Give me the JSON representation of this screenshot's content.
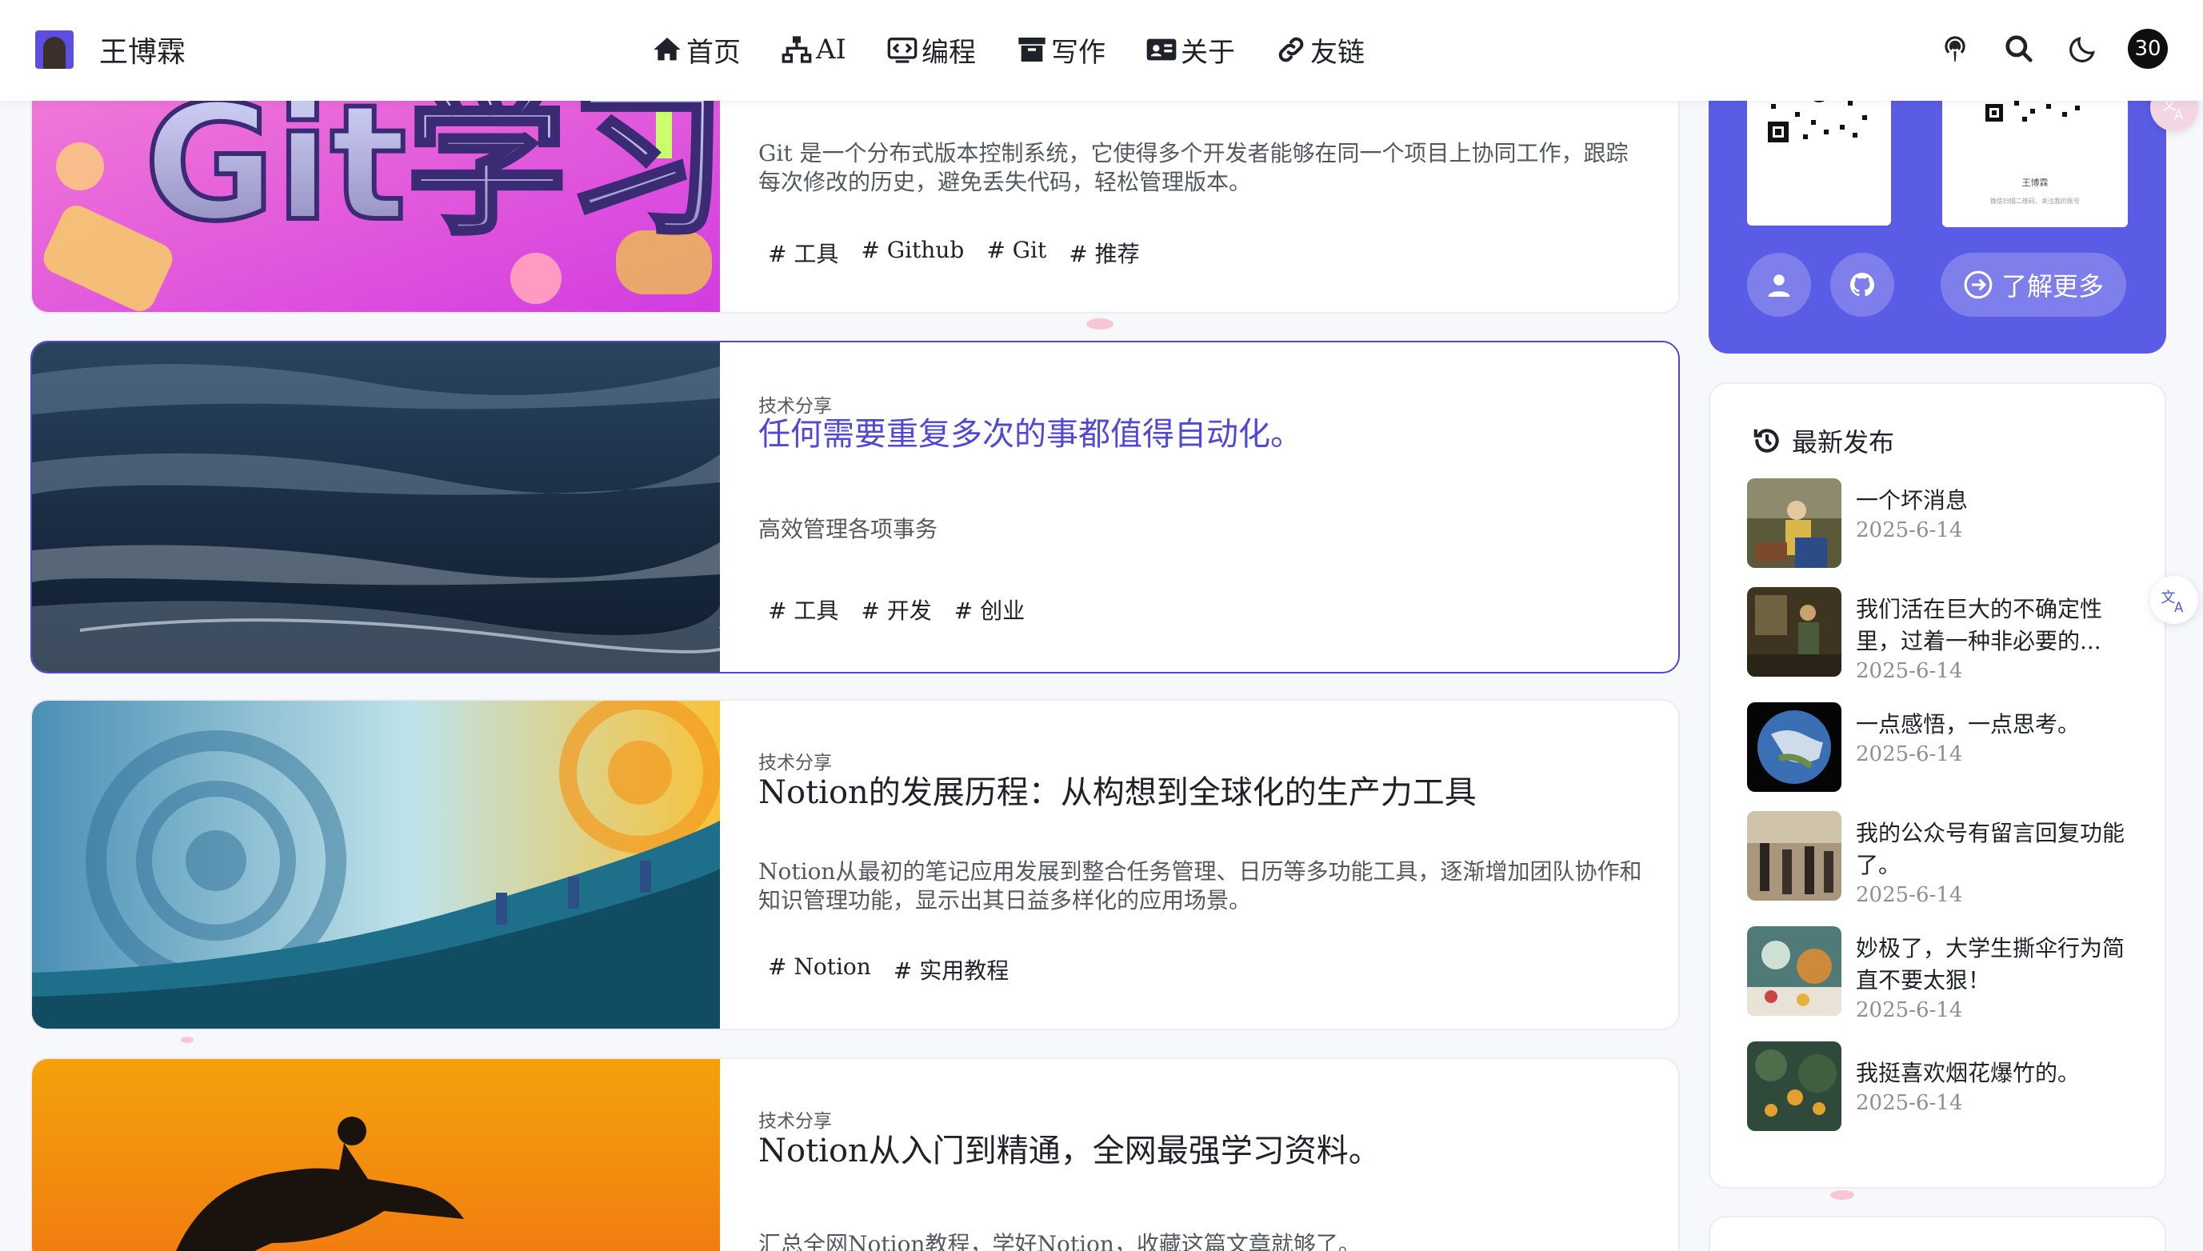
{
  "site": {
    "name": "王博霖"
  },
  "nav": [
    {
      "label": "首页",
      "icon": "home-icon"
    },
    {
      "label": "AI",
      "icon": "sitemap-icon"
    },
    {
      "label": "编程",
      "icon": "code-icon"
    },
    {
      "label": "写作",
      "icon": "archive-icon"
    },
    {
      "label": "关于",
      "icon": "id-card-icon"
    },
    {
      "label": "友链",
      "icon": "link-icon"
    }
  ],
  "header": {
    "count_badge": "30"
  },
  "posts": [
    {
      "category": "",
      "title": "",
      "description": "Git 是一个分布式版本控制系统，它使得多个开发者能够在同一个项目上协同工作，跟踪每次修改的历史，避免丢失代码，轻松管理版本。",
      "tags": [
        "# 工具",
        "# Github",
        "# Git",
        "# 推荐"
      ],
      "image_text": "Git学习"
    },
    {
      "category": "技术分享",
      "title": "任何需要重复多次的事都值得自动化。",
      "description": "高效管理各项事务",
      "tags": [
        "# 工具",
        "# 开发",
        "# 创业"
      ]
    },
    {
      "category": "技术分享",
      "title": "Notion的发展历程：从构想到全球化的生产力工具",
      "description": "Notion从最初的笔记应用发展到整合任务管理、日历等多功能工具，逐渐增加团队协作和知识管理功能，显示出其日益多样化的应用场景。",
      "tags": [
        "# Notion",
        "# 实用教程"
      ]
    },
    {
      "category": "技术分享",
      "title": "Notion从入门到精通，全网最强学习资料。",
      "description": "汇总全网Notion教程，学好Notion，收藏这篇文章就够了。",
      "tags": []
    }
  ],
  "profile": {
    "qr_left_caption": "",
    "qr_right_caption": "王博霖",
    "qr_right_sub": "微信扫描二维码，关注我的账号",
    "more_label": "了解更多"
  },
  "recent": {
    "heading": "最新发布",
    "items": [
      {
        "title": "一个坏消息",
        "date": "2025-6-14"
      },
      {
        "title": "我们活在巨大的不确定性里，过着一种非必要的...",
        "date": "2025-6-14"
      },
      {
        "title": "一点感悟，一点思考。",
        "date": "2025-6-14"
      },
      {
        "title": "我的公众号有留言回复功能了。",
        "date": "2025-6-14"
      },
      {
        "title": "妙极了，大学生撕伞行为简直不要太狠！",
        "date": "2025-6-14"
      },
      {
        "title": "我挺喜欢烟花爆竹的。",
        "date": "2025-6-14"
      }
    ]
  },
  "colors": {
    "accent": "#5248d6",
    "profile_bg": "#5b5ce6",
    "text": "#1f2329",
    "muted": "#55595f"
  }
}
